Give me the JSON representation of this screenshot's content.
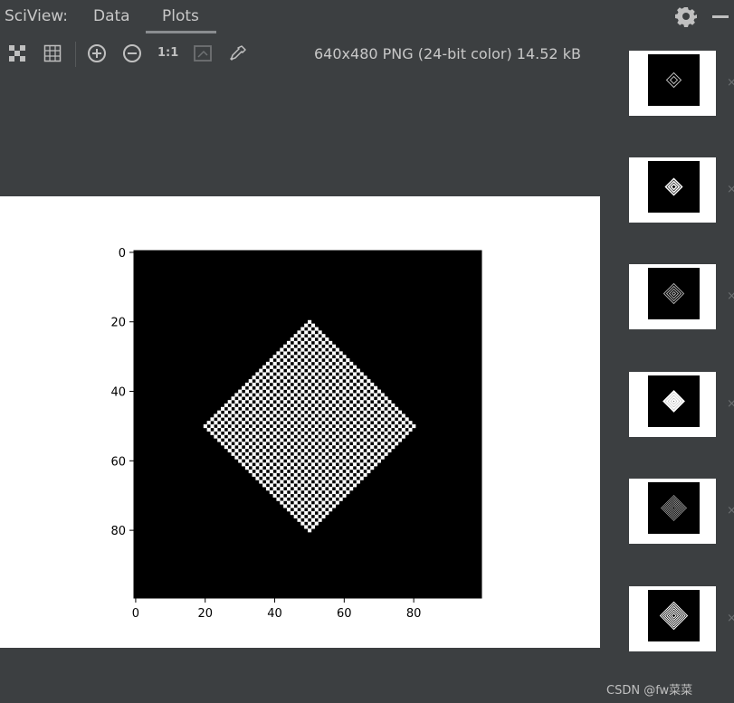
{
  "header": {
    "app_title": "SciView:",
    "tabs": [
      {
        "label": "Data",
        "active": false
      },
      {
        "label": "Plots",
        "active": true
      }
    ]
  },
  "toolbar": {
    "icons": [
      "checkerboard-icon",
      "grid-icon",
      "zoom-in-icon",
      "zoom-out-icon",
      "actual-size-icon",
      "fit-window-icon",
      "color-picker-icon"
    ],
    "actual_size_label": "1:1",
    "image_info": "640x480 PNG (24-bit color) 14.52 kB"
  },
  "chart_data": {
    "type": "heatmap",
    "description_values": "binary image 100x100: pixel value 1 where |x-50|+|y-50| <= 30 and (|x-50|+|y-50|) is even, else 0",
    "center": [
      50,
      50
    ],
    "max_radius": 30,
    "xlim": [
      0,
      99
    ],
    "ylim": [
      99,
      0
    ],
    "x_ticks": [
      0,
      20,
      40,
      60,
      80
    ],
    "y_ticks": [
      0,
      20,
      40,
      60,
      80
    ],
    "colormap": [
      "#000000",
      "#ffffff"
    ]
  },
  "thumbnails": [
    {
      "pattern": "small-diamond-outline"
    },
    {
      "pattern": "small-diamond-bold"
    },
    {
      "pattern": "medium-diamond-gray"
    },
    {
      "pattern": "medium-diamond-bold"
    },
    {
      "pattern": "large-diamond-fine"
    },
    {
      "pattern": "large-diamond-dense"
    }
  ],
  "watermark": "CSDN @fw菜菜"
}
